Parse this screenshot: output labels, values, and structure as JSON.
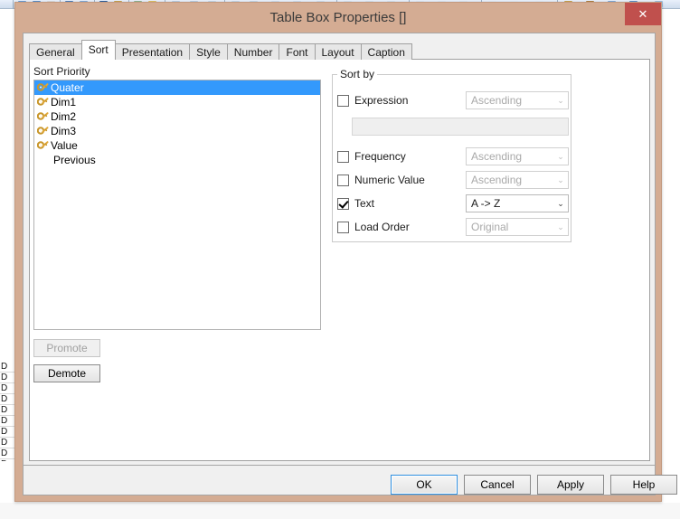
{
  "window": {
    "title": "Table Box Properties []",
    "close_label": "✕",
    "titlebar_color": "#d4ac93",
    "close_color": "#c0504d"
  },
  "tabs": [
    {
      "label": "General",
      "active": false
    },
    {
      "label": "Sort",
      "active": true
    },
    {
      "label": "Presentation",
      "active": false
    },
    {
      "label": "Style",
      "active": false
    },
    {
      "label": "Number",
      "active": false
    },
    {
      "label": "Font",
      "active": false
    },
    {
      "label": "Layout",
      "active": false
    },
    {
      "label": "Caption",
      "active": false
    }
  ],
  "sort_priority": {
    "label": "Sort Priority",
    "selection_color": "#3399fc",
    "items": [
      {
        "text": "Quater",
        "has_key_icon": true,
        "selected": true
      },
      {
        "text": "Dim1",
        "has_key_icon": true,
        "selected": false
      },
      {
        "text": "Dim2",
        "has_key_icon": true,
        "selected": false
      },
      {
        "text": "Dim3",
        "has_key_icon": true,
        "selected": false
      },
      {
        "text": "Value",
        "has_key_icon": true,
        "selected": false
      },
      {
        "text": "Previous",
        "has_key_icon": false,
        "selected": false
      }
    ]
  },
  "priority_buttons": {
    "promote": "Promote",
    "demote": "Demote"
  },
  "sort_by": {
    "legend": "Sort by",
    "rows": [
      {
        "label": "Expression",
        "checked": false,
        "value": "Ascending",
        "enabled": false
      },
      {
        "label": "Frequency",
        "checked": false,
        "value": "Ascending",
        "enabled": false
      },
      {
        "label": "Numeric Value",
        "checked": false,
        "value": "Ascending",
        "enabled": false
      },
      {
        "label": "Text",
        "checked": true,
        "value": "A -> Z",
        "enabled": true
      },
      {
        "label": "Load Order",
        "checked": false,
        "value": "Original",
        "enabled": false
      }
    ],
    "expression_input": {
      "value": "",
      "placeholder": ""
    },
    "dropdown_arrow": "⌄"
  },
  "footer": {
    "ok": "OK",
    "cancel": "Cancel",
    "apply": "Apply",
    "help": "Help"
  },
  "background": {
    "row_fragments": [
      "D",
      "D",
      "D",
      "D",
      "D",
      "D",
      "D",
      "D",
      "D",
      "D"
    ]
  }
}
